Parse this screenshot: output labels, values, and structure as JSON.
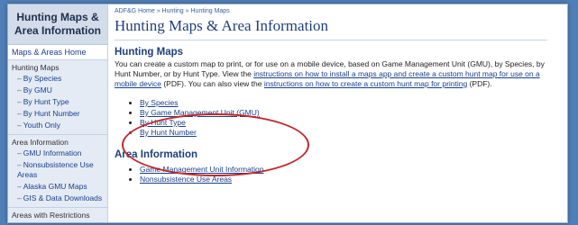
{
  "sidebar": {
    "title": "Hunting Maps & Area Information",
    "home_link": "Maps & Areas Home",
    "groups": [
      {
        "label": "Hunting Maps",
        "items": [
          "By Species",
          "By GMU",
          "By Hunt Type",
          "By Hunt Number",
          "Youth Only"
        ]
      },
      {
        "label": "Area Information",
        "items": [
          "GMU Information",
          "Nonsubsistence Use Areas",
          "Alaska GMU Maps",
          "GIS & Data Downloads"
        ]
      },
      {
        "label": "Areas with Restrictions",
        "items": []
      }
    ]
  },
  "breadcrumb": {
    "items": [
      "ADF&G Home",
      "Hunting",
      "Hunting Maps"
    ],
    "separator": "»"
  },
  "page_title": "Hunting Maps & Area Information",
  "hunting_maps": {
    "heading": "Hunting Maps",
    "intro_1": "You can create a custom map to print, or for use on a mobile device, based on Game Management Unit (GMU), by Species, by Hunt Number, or by Hunt Type. View the ",
    "link_1": "instructions on how to install a maps app and create a custom hunt map for use on a mobile device",
    "intro_2": " (PDF). You can also view the ",
    "link_2": "instructions on how to create a custom hunt map for printing",
    "intro_3": " (PDF).",
    "links": [
      "By Species",
      "By Game Management Unit (GMU)",
      "By Hunt Type",
      "By Hunt Number"
    ]
  },
  "area_information": {
    "heading": "Area Information",
    "links": [
      "Game Management Unit Information",
      "Nonsubsistence Use Areas"
    ]
  },
  "colors": {
    "annotation_oval": "#c0282d",
    "link": "#1a3f8a",
    "heading": "#1f3f7a"
  }
}
